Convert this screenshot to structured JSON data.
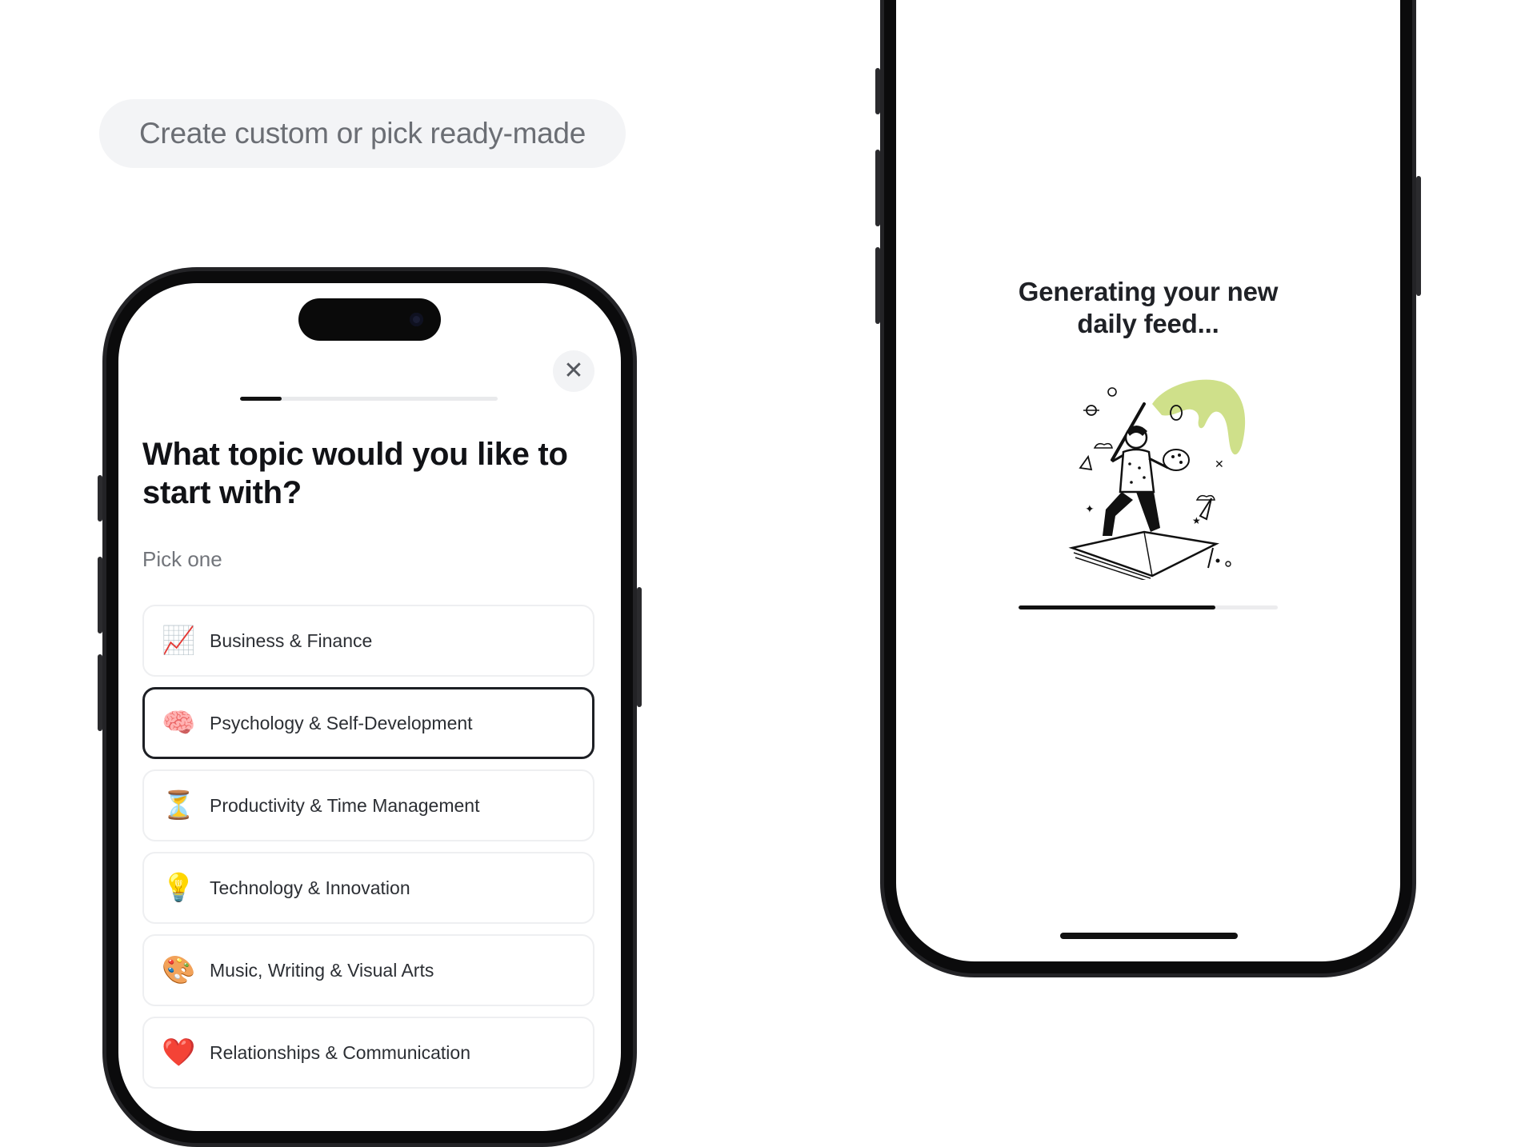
{
  "header": {
    "pill_text": "Create custom or pick ready-made"
  },
  "topic_screen": {
    "close_symbol": "✕",
    "progress": 0.16,
    "question": "What topic would you like to start with?",
    "subtitle": "Pick one",
    "options": [
      {
        "emoji": "📈",
        "icon": "chart-increasing-icon",
        "label": "Business & Finance",
        "selected": false
      },
      {
        "emoji": "🧠",
        "icon": "brain-icon",
        "label": "Psychology & Self-Development",
        "selected": true
      },
      {
        "emoji": "⏳",
        "icon": "hourglass-icon",
        "label": "Productivity & Time Management",
        "selected": false
      },
      {
        "emoji": "💡",
        "icon": "light-bulb-icon",
        "label": "Technology & Innovation",
        "selected": false
      },
      {
        "emoji": "🎨",
        "icon": "palette-icon",
        "label": "Music, Writing & Visual Arts",
        "selected": false
      },
      {
        "emoji": "❤️",
        "icon": "red-heart-icon",
        "label": "Relationships & Communication",
        "selected": false
      }
    ]
  },
  "loading_screen": {
    "title_line1": "Generating your new",
    "title_line2": "daily feed...",
    "progress": 0.76,
    "accent_color": "#cfe08a"
  }
}
